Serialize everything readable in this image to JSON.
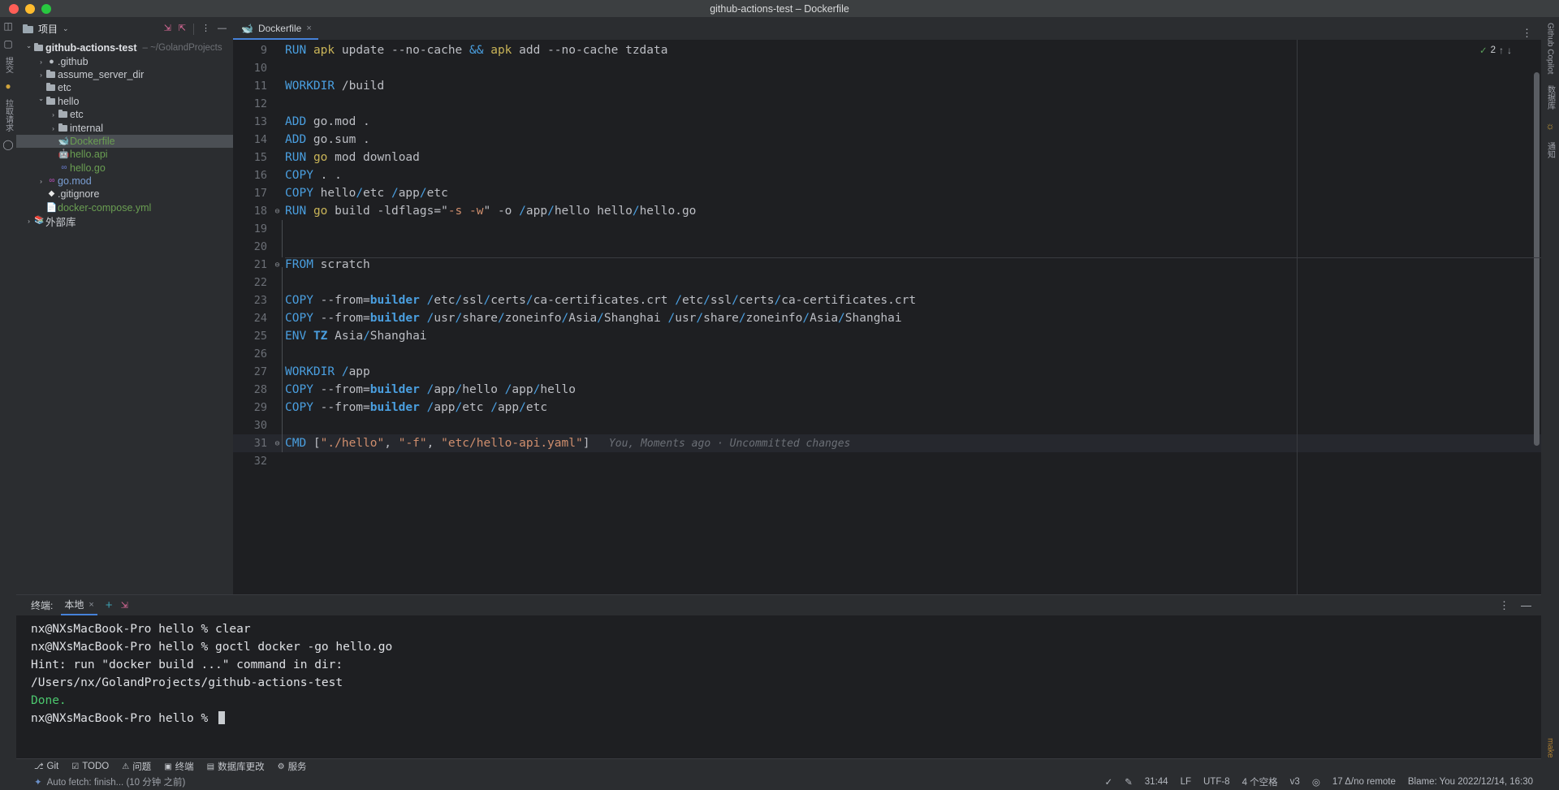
{
  "window": {
    "title": "github-actions-test – Dockerfile"
  },
  "traffic_lights": [
    "close",
    "minimize",
    "zoom"
  ],
  "toolbar": {
    "project_label": "项目",
    "chevron": "⌄",
    "expand_icon": "expand-all",
    "collapse_icon": "collapse-all",
    "more_icon": "⋮",
    "hide_icon": "—"
  },
  "left_rail": {
    "items": [
      "项目",
      "提交",
      "拉取请求"
    ],
    "icons": [
      "project-icon",
      "commit-icon",
      "bulb-icon",
      "pull-request-icon",
      "github-icon"
    ]
  },
  "right_rail": {
    "items": [
      "Github Copilot",
      "数据库",
      "通知"
    ],
    "icons": [
      "ai-icon",
      "database-icon",
      "notifications-icon",
      "make-icon"
    ]
  },
  "editor_tabs": [
    {
      "label": "Dockerfile",
      "icon": "docker-whale-icon",
      "active": true,
      "closable": true
    }
  ],
  "tree": [
    {
      "depth": 0,
      "arrow": "open",
      "icon": "folder-icon",
      "name": "github-actions-test",
      "bold": true,
      "color": "default",
      "path": "– ~/GolandProjects"
    },
    {
      "depth": 1,
      "arrow": "closed",
      "icon": "github-icon",
      "name": ".github",
      "bold": false,
      "color": "default"
    },
    {
      "depth": 1,
      "arrow": "closed",
      "icon": "folder-icon",
      "name": "assume_server_dir",
      "bold": false,
      "color": "default"
    },
    {
      "depth": 1,
      "arrow": "none",
      "icon": "folder-icon",
      "name": "etc",
      "bold": false,
      "color": "default"
    },
    {
      "depth": 1,
      "arrow": "open",
      "icon": "folder-icon",
      "name": "hello",
      "bold": false,
      "color": "default"
    },
    {
      "depth": 2,
      "arrow": "closed",
      "icon": "folder-icon",
      "name": "etc",
      "bold": false,
      "color": "default"
    },
    {
      "depth": 2,
      "arrow": "closed",
      "icon": "folder-icon",
      "name": "internal",
      "bold": false,
      "color": "default"
    },
    {
      "depth": 2,
      "arrow": "none",
      "icon": "docker-icon",
      "name": "Dockerfile",
      "bold": false,
      "color": "green",
      "selected": true
    },
    {
      "depth": 2,
      "arrow": "none",
      "icon": "api-icon",
      "name": "hello.api",
      "bold": false,
      "color": "green"
    },
    {
      "depth": 2,
      "arrow": "none",
      "icon": "go-icon",
      "name": "hello.go",
      "bold": false,
      "color": "green"
    },
    {
      "depth": 1,
      "arrow": "closed",
      "icon": "gomod-icon",
      "name": "go.mod",
      "bold": false,
      "color": "blue"
    },
    {
      "depth": 1,
      "arrow": "none",
      "icon": "gitignore-icon",
      "name": ".gitignore",
      "bold": false,
      "color": "default"
    },
    {
      "depth": 1,
      "arrow": "none",
      "icon": "yaml-icon",
      "name": "docker-compose.yml",
      "bold": false,
      "color": "green"
    },
    {
      "depth": 0,
      "arrow": "closed",
      "icon": "library-icon",
      "name": "外部库",
      "bold": false,
      "color": "default"
    }
  ],
  "editor": {
    "inspection_count": "2",
    "inspection_icon": "inspections-icon",
    "arrow_up": "↑",
    "arrow_down": "↓",
    "blame_text": "You, Moments ago · Uncommitted changes",
    "lines": [
      {
        "n": "9",
        "fold": "",
        "tokens": [
          {
            "t": "RUN",
            "c": "kw"
          },
          {
            "t": " ",
            "c": "wht"
          },
          {
            "t": "apk",
            "c": "yel"
          },
          {
            "t": " update --no-cache ",
            "c": "wht"
          },
          {
            "t": "&&",
            "c": "kw"
          },
          {
            "t": " ",
            "c": "wht"
          },
          {
            "t": "apk",
            "c": "yel"
          },
          {
            "t": " add --no-cache tzdata",
            "c": "wht"
          }
        ]
      },
      {
        "n": "10",
        "fold": "",
        "tokens": []
      },
      {
        "n": "11",
        "fold": "",
        "tokens": [
          {
            "t": "WORKDIR",
            "c": "kw"
          },
          {
            "t": " ",
            "c": "wht"
          },
          {
            "t": "/build",
            "c": "wht"
          }
        ]
      },
      {
        "n": "12",
        "fold": "",
        "tokens": []
      },
      {
        "n": "13",
        "fold": "",
        "tokens": [
          {
            "t": "ADD",
            "c": "kw"
          },
          {
            "t": " go.mod .",
            "c": "wht"
          }
        ]
      },
      {
        "n": "14",
        "fold": "",
        "tokens": [
          {
            "t": "ADD",
            "c": "kw"
          },
          {
            "t": " go.sum .",
            "c": "wht"
          }
        ]
      },
      {
        "n": "15",
        "fold": "",
        "tokens": [
          {
            "t": "RUN",
            "c": "kw"
          },
          {
            "t": " ",
            "c": "wht"
          },
          {
            "t": "go",
            "c": "yel"
          },
          {
            "t": " mod download",
            "c": "wht"
          }
        ]
      },
      {
        "n": "16",
        "fold": "",
        "tokens": [
          {
            "t": "COPY",
            "c": "kw"
          },
          {
            "t": " . .",
            "c": "wht"
          }
        ]
      },
      {
        "n": "17",
        "fold": "",
        "tokens": [
          {
            "t": "COPY",
            "c": "kw"
          },
          {
            "t": " hello",
            "c": "wht"
          },
          {
            "t": "/",
            "c": "kw"
          },
          {
            "t": "etc ",
            "c": "wht"
          },
          {
            "t": "/",
            "c": "kw"
          },
          {
            "t": "app",
            "c": "wht"
          },
          {
            "t": "/",
            "c": "kw"
          },
          {
            "t": "etc",
            "c": "wht"
          }
        ]
      },
      {
        "n": "18",
        "fold": "end",
        "tokens": [
          {
            "t": "RUN",
            "c": "kw"
          },
          {
            "t": " ",
            "c": "wht"
          },
          {
            "t": "go",
            "c": "yel"
          },
          {
            "t": " build -ldflags=",
            "c": "wht"
          },
          {
            "t": "\"",
            "c": "wht"
          },
          {
            "t": "-s -w",
            "c": "org"
          },
          {
            "t": "\"",
            "c": "wht"
          },
          {
            "t": " -o ",
            "c": "wht"
          },
          {
            "t": "/",
            "c": "kw"
          },
          {
            "t": "app",
            "c": "wht"
          },
          {
            "t": "/",
            "c": "kw"
          },
          {
            "t": "hello hello",
            "c": "wht"
          },
          {
            "t": "/",
            "c": "kw"
          },
          {
            "t": "hello.go",
            "c": "wht"
          }
        ]
      },
      {
        "n": "19",
        "fold": "",
        "tokens": []
      },
      {
        "n": "20",
        "fold": "",
        "tokens": []
      },
      {
        "n": "21",
        "fold": "start",
        "tokens": [
          {
            "t": "FROM",
            "c": "kw"
          },
          {
            "t": " scratch",
            "c": "wht"
          }
        ]
      },
      {
        "n": "22",
        "fold": "",
        "tokens": []
      },
      {
        "n": "23",
        "fold": "",
        "tokens": [
          {
            "t": "COPY",
            "c": "kw"
          },
          {
            "t": " --from=",
            "c": "wht"
          },
          {
            "t": "builder",
            "c": "bld"
          },
          {
            "t": " ",
            "c": "wht"
          },
          {
            "t": "/",
            "c": "kw"
          },
          {
            "t": "etc",
            "c": "wht"
          },
          {
            "t": "/",
            "c": "kw"
          },
          {
            "t": "ssl",
            "c": "wht"
          },
          {
            "t": "/",
            "c": "kw"
          },
          {
            "t": "certs",
            "c": "wht"
          },
          {
            "t": "/",
            "c": "kw"
          },
          {
            "t": "ca-certificates.crt ",
            "c": "wht"
          },
          {
            "t": "/",
            "c": "kw"
          },
          {
            "t": "etc",
            "c": "wht"
          },
          {
            "t": "/",
            "c": "kw"
          },
          {
            "t": "ssl",
            "c": "wht"
          },
          {
            "t": "/",
            "c": "kw"
          },
          {
            "t": "certs",
            "c": "wht"
          },
          {
            "t": "/",
            "c": "kw"
          },
          {
            "t": "ca-certificates.crt",
            "c": "wht"
          }
        ]
      },
      {
        "n": "24",
        "fold": "",
        "tokens": [
          {
            "t": "COPY",
            "c": "kw"
          },
          {
            "t": " --from=",
            "c": "wht"
          },
          {
            "t": "builder",
            "c": "bld"
          },
          {
            "t": " ",
            "c": "wht"
          },
          {
            "t": "/",
            "c": "kw"
          },
          {
            "t": "usr",
            "c": "wht"
          },
          {
            "t": "/",
            "c": "kw"
          },
          {
            "t": "share",
            "c": "wht"
          },
          {
            "t": "/",
            "c": "kw"
          },
          {
            "t": "zoneinfo",
            "c": "wht"
          },
          {
            "t": "/",
            "c": "kw"
          },
          {
            "t": "Asia",
            "c": "wht"
          },
          {
            "t": "/",
            "c": "kw"
          },
          {
            "t": "Shanghai ",
            "c": "wht"
          },
          {
            "t": "/",
            "c": "kw"
          },
          {
            "t": "usr",
            "c": "wht"
          },
          {
            "t": "/",
            "c": "kw"
          },
          {
            "t": "share",
            "c": "wht"
          },
          {
            "t": "/",
            "c": "kw"
          },
          {
            "t": "zoneinfo",
            "c": "wht"
          },
          {
            "t": "/",
            "c": "kw"
          },
          {
            "t": "Asia",
            "c": "wht"
          },
          {
            "t": "/",
            "c": "kw"
          },
          {
            "t": "Shanghai",
            "c": "wht"
          }
        ]
      },
      {
        "n": "25",
        "fold": "",
        "tokens": [
          {
            "t": "ENV",
            "c": "kw"
          },
          {
            "t": " ",
            "c": "wht"
          },
          {
            "t": "TZ",
            "c": "bld"
          },
          {
            "t": " Asia",
            "c": "wht"
          },
          {
            "t": "/",
            "c": "kw"
          },
          {
            "t": "Shanghai",
            "c": "wht"
          }
        ]
      },
      {
        "n": "26",
        "fold": "",
        "tokens": []
      },
      {
        "n": "27",
        "fold": "",
        "tokens": [
          {
            "t": "WORKDIR",
            "c": "kw"
          },
          {
            "t": " ",
            "c": "wht"
          },
          {
            "t": "/",
            "c": "kw"
          },
          {
            "t": "app",
            "c": "wht"
          }
        ]
      },
      {
        "n": "28",
        "fold": "",
        "tokens": [
          {
            "t": "COPY",
            "c": "kw"
          },
          {
            "t": " --from=",
            "c": "wht"
          },
          {
            "t": "builder",
            "c": "bld"
          },
          {
            "t": " ",
            "c": "wht"
          },
          {
            "t": "/",
            "c": "kw"
          },
          {
            "t": "app",
            "c": "wht"
          },
          {
            "t": "/",
            "c": "kw"
          },
          {
            "t": "hello ",
            "c": "wht"
          },
          {
            "t": "/",
            "c": "kw"
          },
          {
            "t": "app",
            "c": "wht"
          },
          {
            "t": "/",
            "c": "kw"
          },
          {
            "t": "hello",
            "c": "wht"
          }
        ]
      },
      {
        "n": "29",
        "fold": "",
        "tokens": [
          {
            "t": "COPY",
            "c": "kw"
          },
          {
            "t": " --from=",
            "c": "wht"
          },
          {
            "t": "builder",
            "c": "bld"
          },
          {
            "t": " ",
            "c": "wht"
          },
          {
            "t": "/",
            "c": "kw"
          },
          {
            "t": "app",
            "c": "wht"
          },
          {
            "t": "/",
            "c": "kw"
          },
          {
            "t": "etc ",
            "c": "wht"
          },
          {
            "t": "/",
            "c": "kw"
          },
          {
            "t": "app",
            "c": "wht"
          },
          {
            "t": "/",
            "c": "kw"
          },
          {
            "t": "etc",
            "c": "wht"
          }
        ]
      },
      {
        "n": "30",
        "fold": "",
        "tokens": []
      },
      {
        "n": "31",
        "fold": "end",
        "current": true,
        "blame": true,
        "tokens": [
          {
            "t": "CMD",
            "c": "kw"
          },
          {
            "t": " [",
            "c": "wht"
          },
          {
            "t": "\"./hello\"",
            "c": "org"
          },
          {
            "t": ", ",
            "c": "wht"
          },
          {
            "t": "\"-f\"",
            "c": "org"
          },
          {
            "t": ", ",
            "c": "wht"
          },
          {
            "t": "\"etc/hello-api.yaml\"",
            "c": "org"
          },
          {
            "t": "]",
            "c": "wht"
          }
        ]
      },
      {
        "n": "32",
        "fold": "",
        "tokens": []
      }
    ]
  },
  "terminal": {
    "title": "终端:",
    "tab_label": "本地",
    "close_icon": "×",
    "add_icon": "+",
    "expand_icon": "expand-terminal-icon",
    "more_icon": "⋮",
    "minimize_icon": "—",
    "lines": [
      {
        "text": "nx@NXsMacBook-Pro hello % clear",
        "color": "default"
      },
      {
        "text": "nx@NXsMacBook-Pro hello % goctl docker -go hello.go",
        "color": "default"
      },
      {
        "text": "Hint: run \"docker build ...\" command in dir:",
        "color": "default"
      },
      {
        "text": "    /Users/nx/GolandProjects/github-actions-test",
        "color": "default"
      },
      {
        "text": "Done.",
        "color": "green"
      },
      {
        "text": "nx@NXsMacBook-Pro hello % ",
        "color": "default",
        "caret": true
      }
    ]
  },
  "tools_bar": [
    {
      "label": "Git",
      "icon": "git-icon"
    },
    {
      "label": "TODO",
      "icon": "todo-icon"
    },
    {
      "label": "问题",
      "icon": "problems-icon"
    },
    {
      "label": "终端",
      "icon": "terminal-icon"
    },
    {
      "label": "数据库更改",
      "icon": "database-changes-icon"
    },
    {
      "label": "服务",
      "icon": "services-icon"
    }
  ],
  "status_bar": {
    "left_icon": "build-icon",
    "left_text": "Auto fetch: finish... (10 分钟 之前)",
    "right": [
      {
        "name": "check-icon",
        "text": "✓"
      },
      {
        "name": "edit-icon",
        "text": "✎"
      },
      {
        "name": "caret-position",
        "text": "31:44"
      },
      {
        "name": "line-separator",
        "text": "LF"
      },
      {
        "name": "file-encoding",
        "text": "UTF-8"
      },
      {
        "name": "indent-setting",
        "text": "4 个空格"
      },
      {
        "name": "branch",
        "text": "v3"
      },
      {
        "name": "lock-icon",
        "text": "◎"
      },
      {
        "name": "vcs-changes",
        "text": "17 Δ/no remote"
      },
      {
        "name": "blame-info",
        "text": "Blame: You 2022/12/14, 16:30"
      }
    ]
  }
}
